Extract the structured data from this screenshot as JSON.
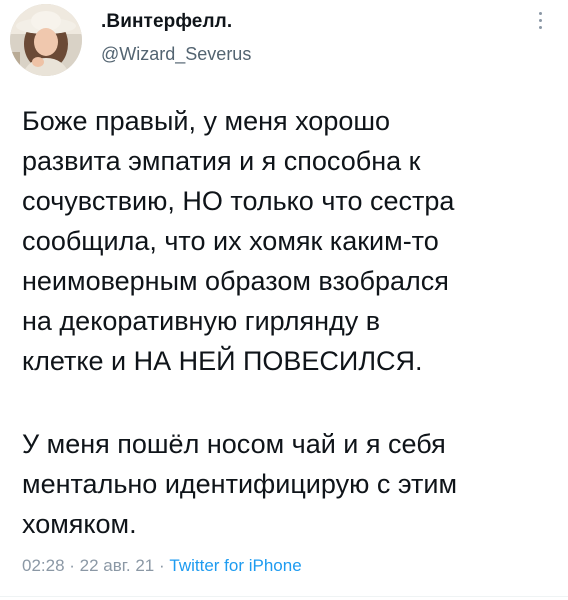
{
  "author": {
    "display_name": ".Винтерфелл.",
    "handle": "@Wizard_Severus"
  },
  "tweet": {
    "paragraph_1": "Боже правый, у меня хорошо\nразвита эмпатия и я способна к\nсочувствию, НО только что сестра\nсообщила, что их хомяк каким-то\nнеимоверным образом взобрался\nна декоративную гирлянду в\nклетке и НА НЕЙ ПОВЕСИЛСЯ.",
    "paragraph_2": "У меня пошёл носом чай и я себя\nментально идентифицирую с этим\nхомяком.",
    "time": "02:28",
    "separator": " · ",
    "date": "22 авг. 21",
    "source": "Twitter for iPhone"
  },
  "icons": {
    "more": "more-vertical-icon",
    "avatar": "profile-photo"
  },
  "colors": {
    "text": "#0f1419",
    "secondary": "#536471",
    "muted": "#8b98a5",
    "link": "#1d9bf0"
  }
}
